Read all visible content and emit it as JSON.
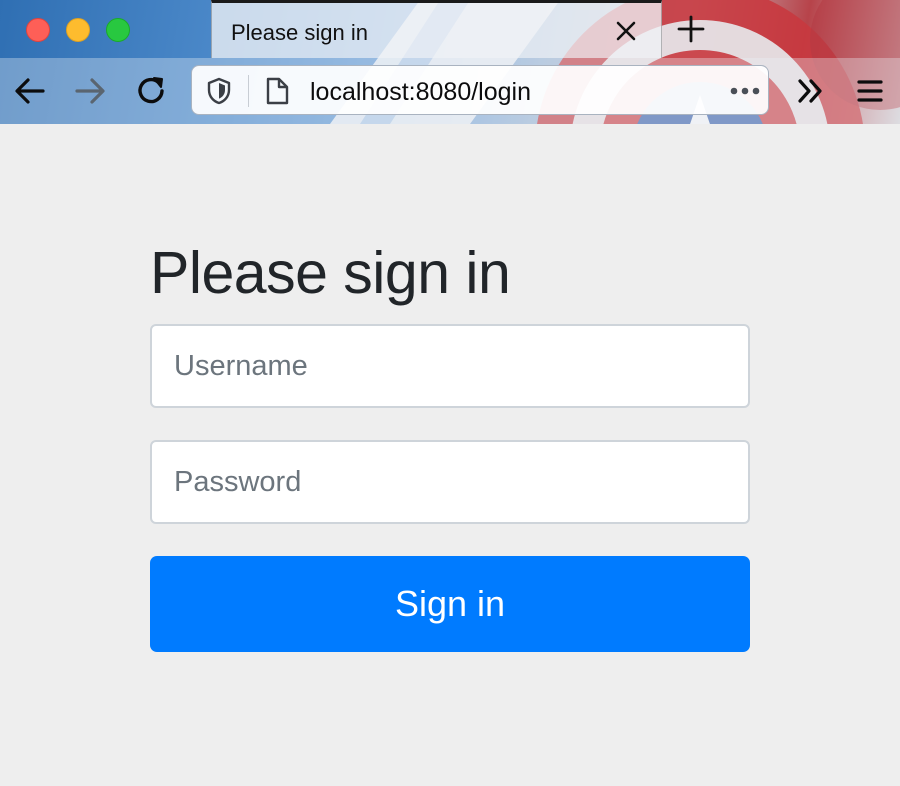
{
  "browser": {
    "tab_title": "Please sign in",
    "url": "localhost:8080/login"
  },
  "icons": {
    "back": "arrow-left-icon",
    "forward": "arrow-right-icon",
    "reload": "reload-icon",
    "tracking_protection": "shield-icon",
    "page_info": "page-icon",
    "page_actions": "more-dots-icon",
    "overflow": "double-chevron-right-icon",
    "menu": "hamburger-menu-icon",
    "close_tab": "close-icon",
    "new_tab": "plus-icon"
  },
  "login": {
    "heading": "Please sign in",
    "username_placeholder": "Username",
    "username_value": "",
    "password_placeholder": "Password",
    "password_value": "",
    "submit_label": "Sign in"
  },
  "colors": {
    "primary_button": "#007bff",
    "page_background": "#eeeeee",
    "heading_text": "#212529"
  }
}
